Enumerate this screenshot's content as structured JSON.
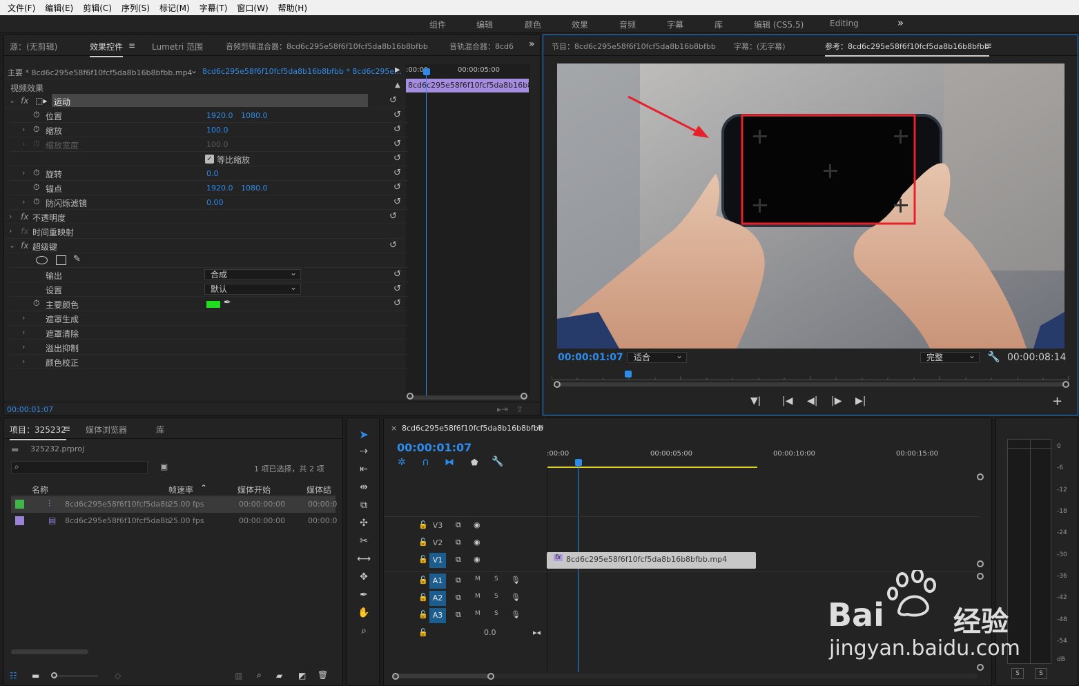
{
  "menu": [
    "文件(F)",
    "编辑(E)",
    "剪辑(C)",
    "序列(S)",
    "标记(M)",
    "字幕(T)",
    "窗口(W)",
    "帮助(H)"
  ],
  "workspaces": [
    "组件",
    "编辑",
    "颜色",
    "效果",
    "音频",
    "字幕",
    "库",
    "编辑 (CS5.5)",
    "Editing",
    "»"
  ],
  "effects_panel": {
    "tabs": [
      "源：(无剪辑)",
      "效果控件",
      "Lumetri 范围",
      "音频剪辑混合器：8cd6c295e58f6f10fcf5da8b16b8bfbb",
      "音轨混合器：8cd6"
    ],
    "more": "»",
    "source_clip": "主要 * 8cd6c295e58f6f10fcf5da8b16b8bfbb.mp4",
    "sequence_clip": "8cd6c295e58f6f10fcf5da8b16b8bfbb * 8cd6c295e...",
    "ruler_start": ":00:00",
    "ruler_mid": "00:00:05:00",
    "clip_bar": "8cd6c295e58f6f10fcf5da8b16b8bf",
    "section": "视频效果",
    "fx": "fx",
    "motion": "运动",
    "position": "位置",
    "pos_x": "1920.0",
    "pos_y": "1080.0",
    "scale": "缩放",
    "scale_val": "100.0",
    "scale_width": "缩放宽度",
    "scale_width_val": "100.0",
    "uniform": "等比缩放",
    "rotation": "旋转",
    "rotation_val": "0.0",
    "anchor": "锚点",
    "anchor_x": "1920.0",
    "anchor_y": "1080.0",
    "flicker": "防闪烁滤镜",
    "flicker_val": "0.00",
    "opacity": "不透明度",
    "remap": "时间重映射",
    "ultrakey": "超级键",
    "output": "输出",
    "output_val": "合成",
    "setting": "设置",
    "setting_val": "默认",
    "key_color": "主要颜色",
    "key_color_hex": "#1ee01e",
    "matte_gen": "遮罩生成",
    "matte_clean": "遮罩清除",
    "spill": "溢出抑制",
    "color_correct": "颜色校正",
    "timecode": "00:00:01:07"
  },
  "program": {
    "tabs": [
      "节目：8cd6c295e58f6f10fcf5da8b16b8bfbb",
      "字幕：(无字幕)",
      "参考：8cd6c295e58f6f10fcf5da8b16b8bfbb"
    ],
    "timecode": "00:00:01:07",
    "fit": "适合",
    "quality": "完整",
    "duration": "00:00:08:14",
    "add": "+"
  },
  "project": {
    "tabs": [
      "项目：325232",
      "媒体浏览器",
      "库"
    ],
    "file": "325232.prproj",
    "selection": "1 项已选择，共 2 项",
    "columns": [
      "名称",
      "帧速率",
      "媒体开始",
      "媒体结"
    ],
    "rows": [
      {
        "name": "8cd6c295e58f6f10fcf5da8b",
        "fps": "25.00 fps",
        "start": "00:00:00:00",
        "end": "00:00:0",
        "color": "#3fb54a"
      },
      {
        "name": "8cd6c295e58f6f10fcf5da8b",
        "fps": "25.00 fps",
        "start": "00:00:00:00",
        "end": "00:00:0",
        "color": "#9a83d6"
      }
    ]
  },
  "timeline": {
    "close": "×",
    "title": "8cd6c295e58f6f10fcf5da8b16b8bfbb",
    "timecode": "00:00:01:07",
    "ruler": [
      ":00:00",
      "00:00:05:00",
      "00:00:10:00",
      "00:00:15:00"
    ],
    "video_tracks": [
      "V3",
      "V2",
      "V1"
    ],
    "audio_tracks": [
      "A1",
      "A2",
      "A3"
    ],
    "mute": "M",
    "solo": "S",
    "master_val": "0.0",
    "clip": "8cd6c295e58f6f10fcf5da8b16b8bfbb.mp4",
    "clip_fx": "fx"
  },
  "meter": {
    "scale": [
      "0",
      "-6",
      "-12",
      "-18",
      "-24",
      "-30",
      "-36",
      "-42",
      "-48",
      "-54",
      "dB"
    ],
    "solo": [
      "S",
      "S"
    ]
  },
  "watermark": {
    "brand": "Bai",
    "brand2": "经验",
    "url": "jingyan.baidu.com"
  },
  "colors": {
    "accent": "#2d8ceb",
    "highlight_red": "#e8202a",
    "track_on": "#1b5d8e"
  }
}
